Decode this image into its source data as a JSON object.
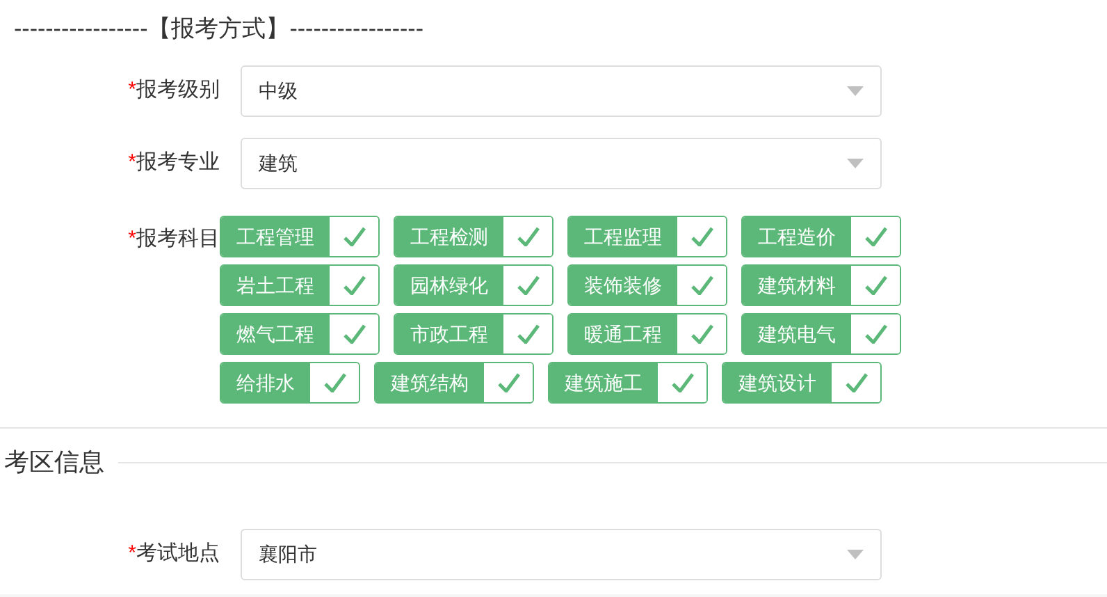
{
  "section_title": "-----------------【报考方式】-----------------",
  "fields": [
    {
      "required_mark": "*",
      "label": "报考级别",
      "value": "中级"
    },
    {
      "required_mark": "*",
      "label": "报考专业",
      "value": "建筑"
    }
  ],
  "subjects": {
    "required_mark": "*",
    "label": "报考科目",
    "items": [
      {
        "label": "工程管理",
        "checked": true
      },
      {
        "label": "工程检测",
        "checked": true
      },
      {
        "label": "工程监理",
        "checked": true
      },
      {
        "label": "工程造价",
        "checked": true
      },
      {
        "label": "岩土工程",
        "checked": true
      },
      {
        "label": "园林绿化",
        "checked": true
      },
      {
        "label": "装饰装修",
        "checked": true
      },
      {
        "label": "建筑材料",
        "checked": true
      },
      {
        "label": "燃气工程",
        "checked": true
      },
      {
        "label": "市政工程",
        "checked": true
      },
      {
        "label": "暖通工程",
        "checked": true
      },
      {
        "label": "建筑电气",
        "checked": true
      },
      {
        "label": "给排水",
        "checked": true
      },
      {
        "label": "建筑结构",
        "checked": true
      },
      {
        "label": "建筑施工",
        "checked": true
      },
      {
        "label": "建筑设计",
        "checked": true
      }
    ]
  },
  "exam_area": {
    "title": "考区信息",
    "fields": [
      {
        "required_mark": "*",
        "label": "考试地点",
        "value": "襄阳市"
      }
    ]
  }
}
